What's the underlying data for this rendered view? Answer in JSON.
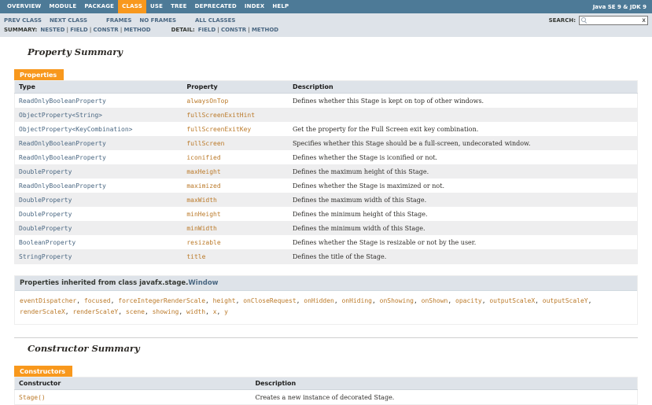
{
  "top_nav": {
    "items": [
      {
        "label": "OVERVIEW",
        "active": false
      },
      {
        "label": "MODULE",
        "active": false
      },
      {
        "label": "PACKAGE",
        "active": false
      },
      {
        "label": "CLASS",
        "active": true
      },
      {
        "label": "USE",
        "active": false
      },
      {
        "label": "TREE",
        "active": false
      },
      {
        "label": "DEPRECATED",
        "active": false
      },
      {
        "label": "INDEX",
        "active": false
      },
      {
        "label": "HELP",
        "active": false
      }
    ],
    "version_label": "Java SE 9 & JDK 9"
  },
  "sub_nav": {
    "groups": [
      [
        "PREV CLASS",
        "NEXT CLASS"
      ],
      [
        "FRAMES",
        "NO FRAMES"
      ],
      [
        "ALL CLASSES"
      ]
    ],
    "search_label": "SEARCH:",
    "search_placeholder": "",
    "search_reset_label": "x",
    "summary_label": "SUMMARY:",
    "summary_items": [
      "NESTED",
      "FIELD",
      "CONSTR",
      "METHOD"
    ],
    "detail_label": "DETAIL:",
    "detail_items": [
      "FIELD",
      "CONSTR",
      "METHOD"
    ]
  },
  "property_summary": {
    "heading": "Property Summary",
    "caption": "Properties",
    "columns": [
      "Type",
      "Property",
      "Description"
    ],
    "rows": [
      {
        "type": "ReadOnlyBooleanProperty",
        "property": "alwaysOnTop",
        "description": "Defines whether this Stage is kept on top of other windows."
      },
      {
        "type": "ObjectProperty<String>",
        "property": "fullScreenExitHint",
        "description": ""
      },
      {
        "type": "ObjectProperty<KeyCombination>",
        "property": "fullScreenExitKey",
        "description": "Get the property for the Full Screen exit key combination."
      },
      {
        "type": "ReadOnlyBooleanProperty",
        "property": "fullScreen",
        "description": "Specifies whether this Stage should be a full-screen, undecorated window."
      },
      {
        "type": "ReadOnlyBooleanProperty",
        "property": "iconified",
        "description": "Defines whether the Stage is iconified or not."
      },
      {
        "type": "DoubleProperty",
        "property": "maxHeight",
        "description": "Defines the maximum height of this Stage."
      },
      {
        "type": "ReadOnlyBooleanProperty",
        "property": "maximized",
        "description": "Defines whether the Stage is maximized or not."
      },
      {
        "type": "DoubleProperty",
        "property": "maxWidth",
        "description": "Defines the maximum width of this Stage."
      },
      {
        "type": "DoubleProperty",
        "property": "minHeight",
        "description": "Defines the minimum height of this Stage."
      },
      {
        "type": "DoubleProperty",
        "property": "minWidth",
        "description": "Defines the minimum width of this Stage."
      },
      {
        "type": "BooleanProperty",
        "property": "resizable",
        "description": "Defines whether the Stage is resizable or not by the user."
      },
      {
        "type": "StringProperty",
        "property": "title",
        "description": "Defines the title of the Stage."
      }
    ]
  },
  "inherited_properties": {
    "heading_prefix": "Properties inherited from class javafx.stage.",
    "heading_link": "Window",
    "members": [
      "eventDispatcher",
      "focused",
      "forceIntegerRenderScale",
      "height",
      "onCloseRequest",
      "onHidden",
      "onHiding",
      "onShowing",
      "onShown",
      "opacity",
      "outputScaleX",
      "outputScaleY",
      "renderScaleX",
      "renderScaleY",
      "scene",
      "showing",
      "width",
      "x",
      "y"
    ]
  },
  "constructor_summary": {
    "heading": "Constructor Summary",
    "caption": "Constructors",
    "columns": [
      "Constructor",
      "Description"
    ],
    "rows": [
      {
        "signature": "Stage()",
        "description": "Creates a new instance of decorated Stage."
      }
    ]
  },
  "colors": {
    "top_bar": "#4D7A97",
    "accent_orange": "#F8981D",
    "sub_bar": "#DEE3E9",
    "link_blue": "#4A6782",
    "member_link_orange": "#BB7A2A",
    "alt_row": "#EEEEEF"
  }
}
